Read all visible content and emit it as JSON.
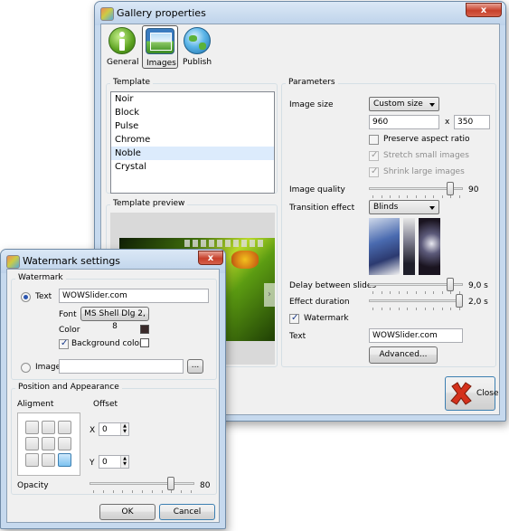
{
  "gallery": {
    "title": "Gallery properties",
    "close_glyph": "x",
    "tabs": [
      {
        "label": "General",
        "icon": "info-icon"
      },
      {
        "label": "Images",
        "icon": "image-icon"
      },
      {
        "label": "Publish",
        "icon": "globe-icon"
      }
    ],
    "template": {
      "label": "Template",
      "items": [
        "Noir",
        "Block",
        "Pulse",
        "Chrome",
        "Noble",
        "Crystal"
      ],
      "selected": "Noble"
    },
    "preview": {
      "label": "Template preview"
    },
    "parameters": {
      "label": "Parameters",
      "image_size_label": "Image size",
      "image_size_value": "Custom size",
      "width": "960",
      "times": "x",
      "height": "350",
      "preserve_aspect": "Preserve aspect ratio",
      "stretch_small": "Stretch small images",
      "shrink_large": "Shrink large images",
      "quality_label": "Image quality",
      "quality_value": "90",
      "quality_level": 90,
      "transition_label": "Transition effect",
      "transition_value": "Blinds",
      "delay_label": "Delay between slides",
      "delay_value": "9,0 s",
      "delay_level": 0.9,
      "duration_label": "Effect duration",
      "duration_value": "2,0 s",
      "duration_level": 1.0,
      "watermark_label": "Watermark",
      "text_label": "Text",
      "text_value": "WOWSlider.com",
      "advanced_button": "Advanced..."
    },
    "close_button": "Close"
  },
  "watermark": {
    "title": "Watermark settings",
    "close_glyph": "x",
    "group_label": "Watermark",
    "text_radio": "Text",
    "text_value": "WOWSlider.com",
    "font_label": "Font",
    "font_value": "MS Shell Dlg 2, 8",
    "color_label": "Color",
    "bg_color_label": "Background color",
    "image_radio": "Image",
    "image_value": "",
    "browse_button": "...",
    "position_label": "Position and Appearance",
    "alignment_label": "Aligment",
    "offset_label": "Offset",
    "x_label": "X",
    "x_value": "0",
    "y_label": "Y",
    "y_value": "0",
    "opacity_label": "Opacity",
    "opacity_value": "80",
    "opacity_level": 80,
    "ok_button": "OK",
    "cancel_button": "Cancel"
  },
  "colors": {
    "window_frame": "#c6d9ee",
    "client": "#f0f0f0",
    "close_red": "#c7402b",
    "selection": "#dcebfc"
  }
}
